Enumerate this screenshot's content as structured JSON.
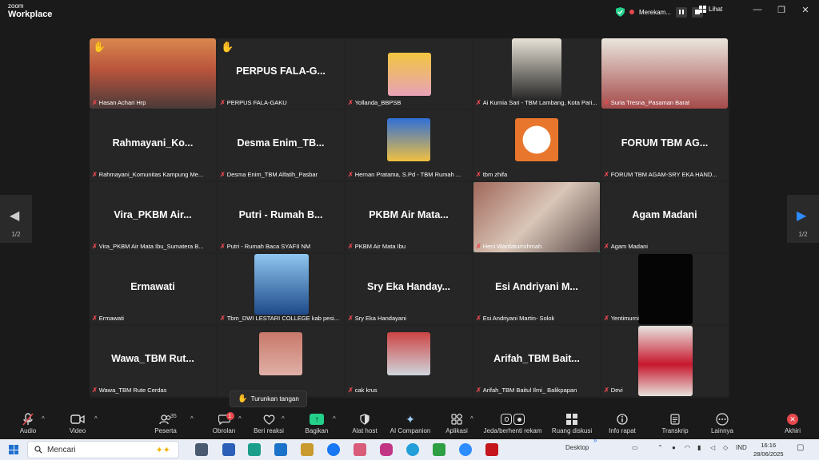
{
  "window": {
    "logo_line1": "zoom",
    "logo_line2": "Workplace",
    "recording_label": "Merekam...",
    "view_label": "Lihat",
    "minimize": "—",
    "restore": "❐",
    "close": "✕"
  },
  "gallery": {
    "page_left": "1/2",
    "page_right": "1/2",
    "tiles": [
      {
        "name": "Hasan Achari Hrp",
        "big": "",
        "hand": true
      },
      {
        "name": "PERPUS FALA-GAKU",
        "big": "PERPUS FALA-G...",
        "hand": true
      },
      {
        "name": "Yollanda_BBPSB",
        "big": ""
      },
      {
        "name": "Ai Kurnia Sari - TBM Lambang, Kota Pari...",
        "big": ""
      },
      {
        "name": "Suria Tresna_Pasaman Barat",
        "big": ""
      },
      {
        "name": "Rahmayani_Komunitas Kampung Me...",
        "big": "Rahmayani_Ko..."
      },
      {
        "name": "Desma Enim_TBM Alfatih_Pasbar",
        "big": "Desma Enim_TB..."
      },
      {
        "name": "Hernan Pratama, S.Pd - TBM Rumah ...",
        "big": ""
      },
      {
        "name": "tbm zhifa",
        "big": ""
      },
      {
        "name": "FORUM TBM AGAM-SRY EKA HAND...",
        "big": "FORUM TBM AG..."
      },
      {
        "name": "Vira_PKBM Air Mata Ibu_Sumatera B...",
        "big": "Vira_PKBM Air..."
      },
      {
        "name": "Putri - Rumah Baca SYAFII NM",
        "big": "Putri - Rumah B..."
      },
      {
        "name": "PKBM Air Mata Ibu",
        "big": "PKBM Air Mata..."
      },
      {
        "name": "Heni Wardaturrohmah",
        "big": "",
        "active": true
      },
      {
        "name": "Agam Madani",
        "big": "Agam Madani"
      },
      {
        "name": "Ermawati",
        "big": "Ermawati"
      },
      {
        "name": "Tbm_DWI LESTARI COLLEGE kab pesi...",
        "big": ""
      },
      {
        "name": "Sry Eka Handayani",
        "big": "Sry Eka Handay..."
      },
      {
        "name": "Esi Andriyani Martin- Solok",
        "big": "Esi Andriyani M..."
      },
      {
        "name": "Yentimurni",
        "big": ""
      },
      {
        "name": "Wawa_TBM Rute Cerdas",
        "big": "Wawa_TBM Rut..."
      },
      {
        "name": "",
        "big": ""
      },
      {
        "name": "cak krus",
        "big": ""
      },
      {
        "name": "Arifah_TBM Baitul Ilmi_ Balikpapan",
        "big": "Arifah_TBM Bait..."
      },
      {
        "name": "Devi",
        "big": ""
      }
    ]
  },
  "popup": {
    "label": "Turunkan tangan"
  },
  "toolbar": {
    "audio": "Audio",
    "video": "Video",
    "participants": "Peserta",
    "participants_count": "35",
    "chat": "Obrolan",
    "chat_badge": "1",
    "react": "Beri reaksi",
    "share": "Bagikan",
    "host": "Alat host",
    "companion": "AI Companion",
    "apps": "Aplikasi",
    "pause_rec": "Jeda/berhenti rekam",
    "breakout": "Ruang diskusi",
    "info": "Info rapat",
    "transcript": "Transkrip",
    "more": "Lainnya",
    "end": "Akhiri"
  },
  "taskbar": {
    "search_placeholder": "Mencari",
    "desktop": "Desktop",
    "lang": "IND",
    "time": "16:16",
    "date": "28/06/2025"
  }
}
